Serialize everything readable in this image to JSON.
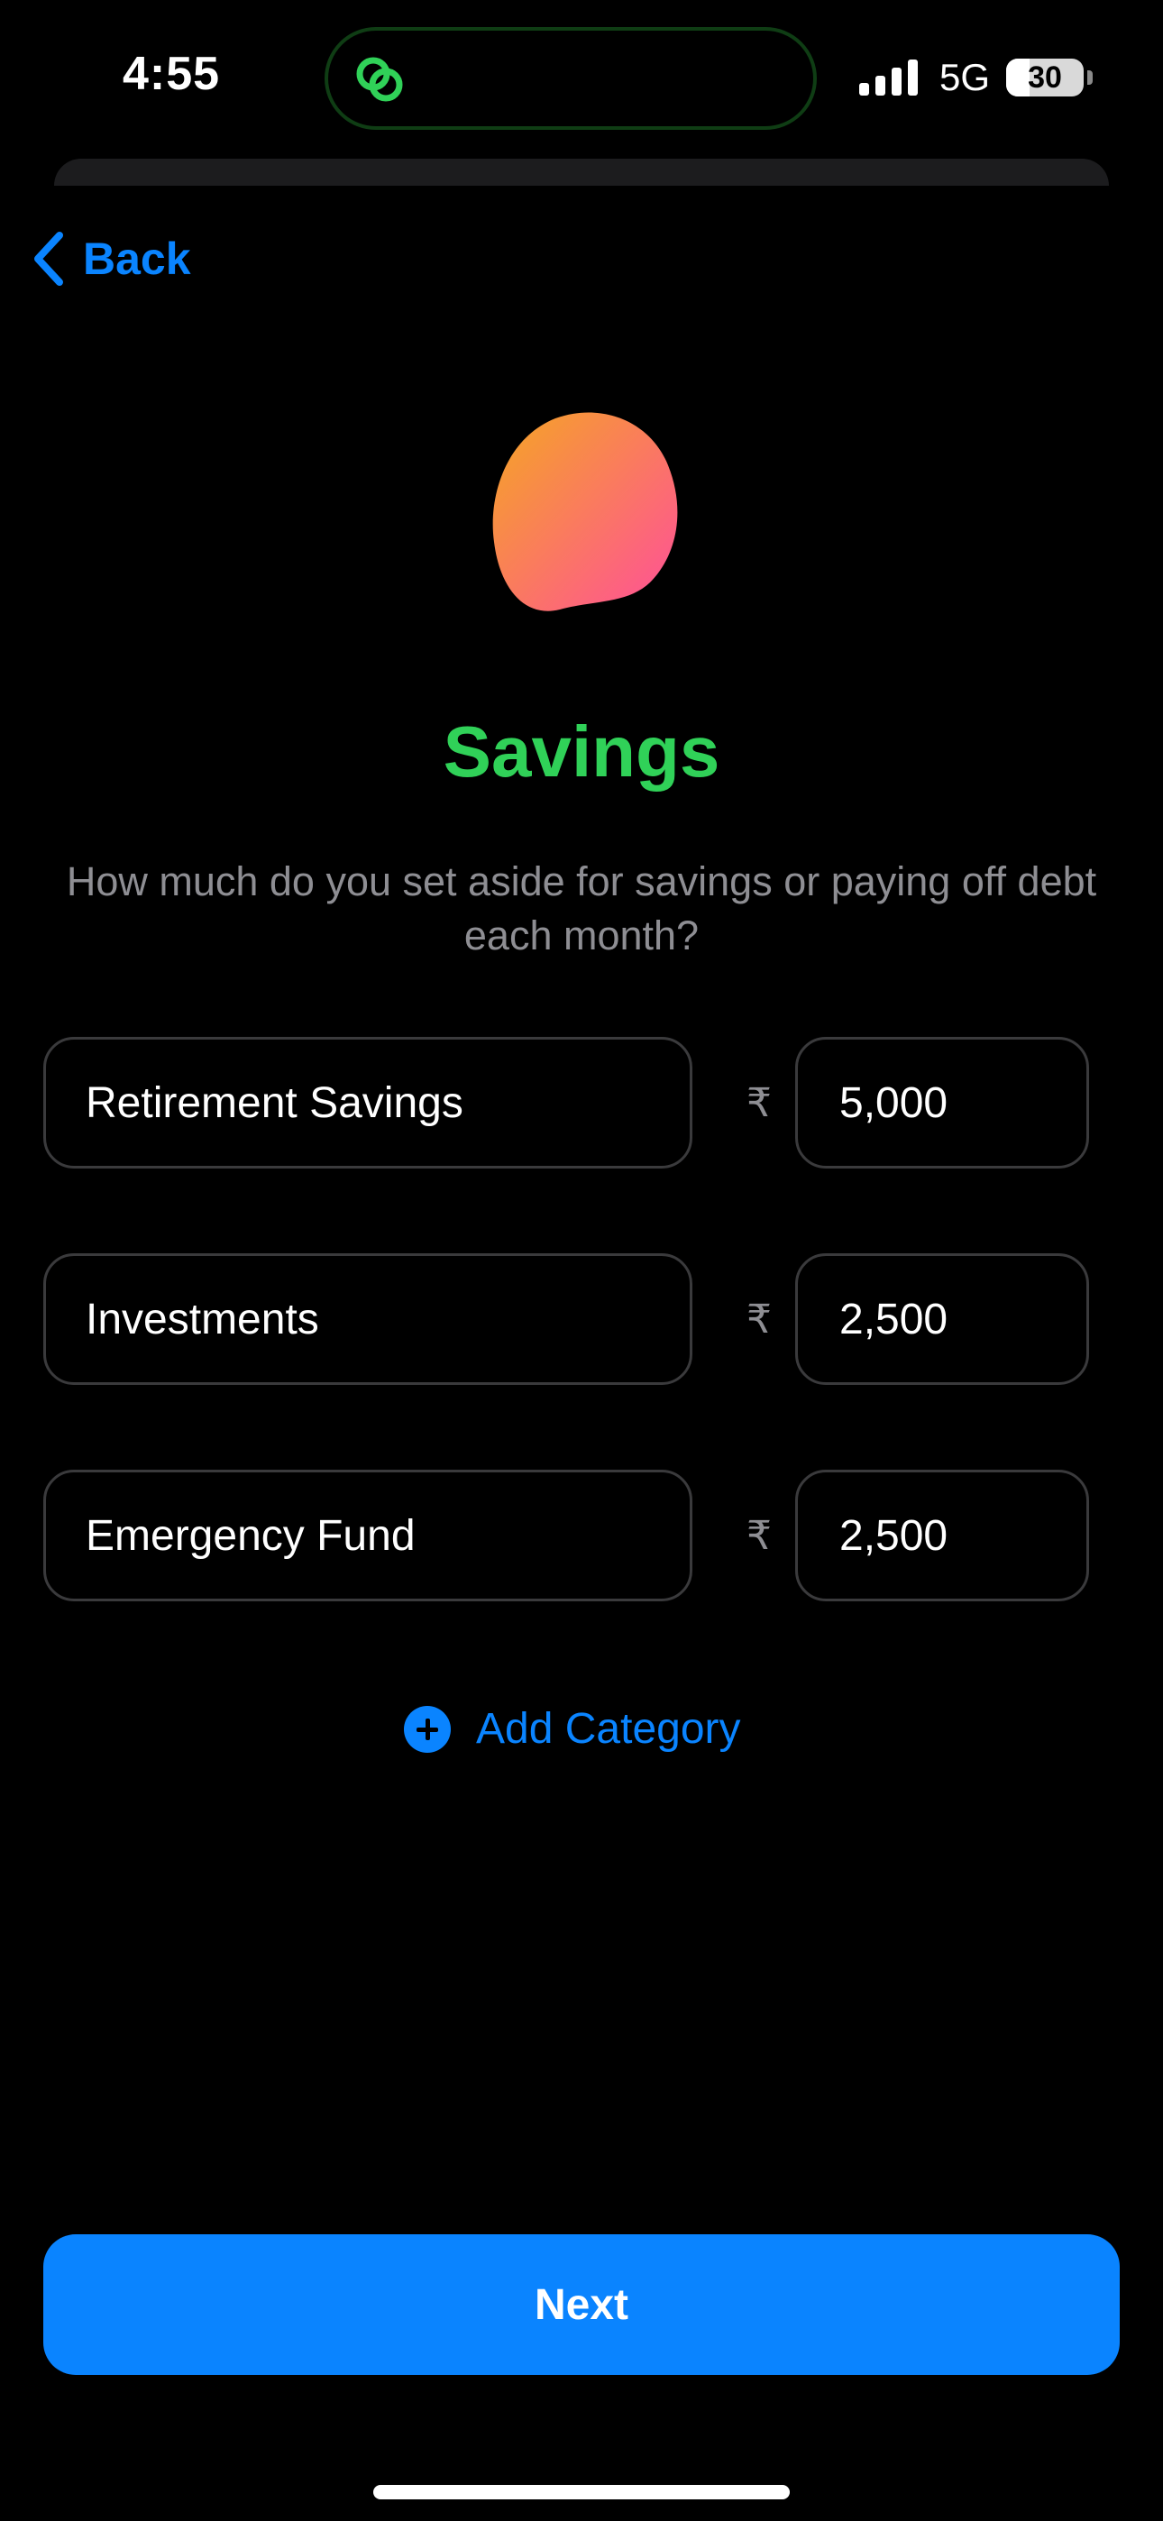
{
  "status_bar": {
    "time": "4:55",
    "network": "5G",
    "battery_level": "30",
    "battery_fraction": 0.3
  },
  "nav": {
    "back_label": "Back"
  },
  "header": {
    "title": "Savings",
    "subtitle": "How much do you set aside for savings or paying off debt each month?"
  },
  "currency_symbol": "₹",
  "categories": [
    {
      "name": "Retirement Savings",
      "amount": "5,000"
    },
    {
      "name": "Investments",
      "amount": "2,500"
    },
    {
      "name": "Emergency Fund",
      "amount": "2,500"
    }
  ],
  "actions": {
    "add_category_label": "Add Category",
    "next_label": "Next"
  },
  "colors": {
    "accent": "#0a84ff",
    "title": "#30d158",
    "subtitle": "#8e8e93",
    "background": "#000000"
  }
}
